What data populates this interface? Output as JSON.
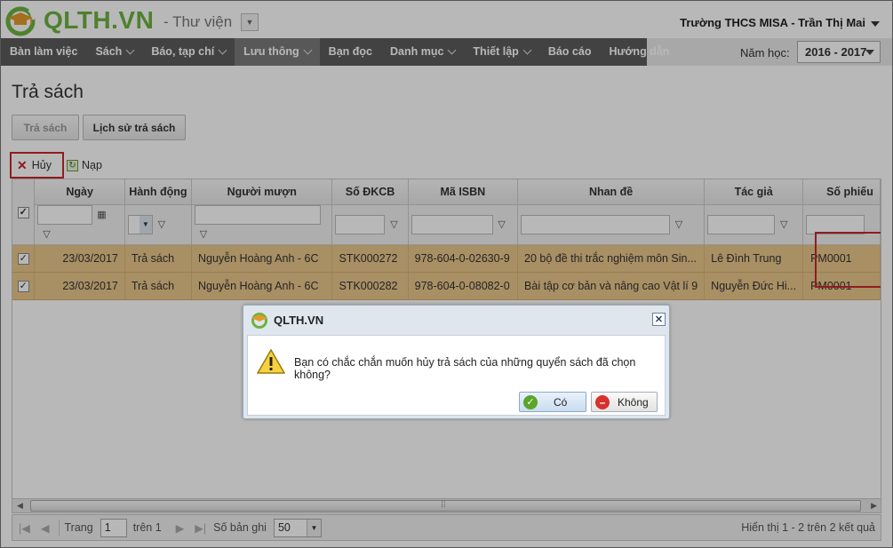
{
  "header": {
    "logo_text": "QLTH.VN",
    "module": "- Thư viện",
    "user": "Trường THCS MISA - Trần Thị Mai"
  },
  "nav": {
    "items": [
      {
        "label": "Bàn làm việc",
        "caret": false
      },
      {
        "label": "Sách",
        "caret": true
      },
      {
        "label": "Báo, tạp chí",
        "caret": true
      },
      {
        "label": "Lưu thông",
        "caret": true,
        "active": true
      },
      {
        "label": "Bạn đọc",
        "caret": false
      },
      {
        "label": "Danh mục",
        "caret": true
      },
      {
        "label": "Thiết lập",
        "caret": true
      },
      {
        "label": "Báo cáo",
        "caret": false
      },
      {
        "label": "Hướng dẫn",
        "caret": false
      }
    ],
    "year_label": "Năm học:",
    "year_value": "2016 - 2017"
  },
  "page": {
    "title": "Trả sách",
    "tabs": [
      "Trả sách",
      "Lịch sử trả sách"
    ]
  },
  "toolbar": {
    "cancel_label": "Hủy",
    "reload_label": "Nạp"
  },
  "grid": {
    "columns": [
      "Ngày",
      "Hành động",
      "Người mượn",
      "Số ĐKCB",
      "Mã ISBN",
      "Nhan đề",
      "Tác giả",
      "Số phiếu"
    ],
    "rows": [
      [
        "23/03/2017",
        "Trả sách",
        "Nguyễn Hoàng Anh - 6C",
        "STK000272",
        "978-604-0-02630-9",
        "20 bộ đề thi trắc nghiệm môn Sin...",
        "Lê Đình Trung",
        "PM0001"
      ],
      [
        "23/03/2017",
        "Trả sách",
        "Nguyễn Hoàng Anh - 6C",
        "STK000282",
        "978-604-0-08082-0",
        "Bài tập cơ bản và nâng cao Vật lí 9",
        "Nguyễn Đức Hi...",
        "PM0001"
      ]
    ]
  },
  "pager": {
    "page_label": "Trang",
    "page_value": "1",
    "of_label": "trên 1",
    "records_label": "Số bản ghi",
    "records_value": "50",
    "summary": "Hiển thị 1 - 2 trên 2 kết quả"
  },
  "dialog": {
    "title": "QLTH.VN",
    "message": "Bạn có chắc chắn muốn hủy trả sách của những quyển sách đã chọn không?",
    "yes_label": "Có",
    "no_label": "Không"
  },
  "colors": {
    "brand": "#6cb33f",
    "nav_bg": "#5c5c5c",
    "row_selected": "#e9c78b",
    "highlight_border": "#c8282d",
    "link": "#2b2bd8"
  }
}
